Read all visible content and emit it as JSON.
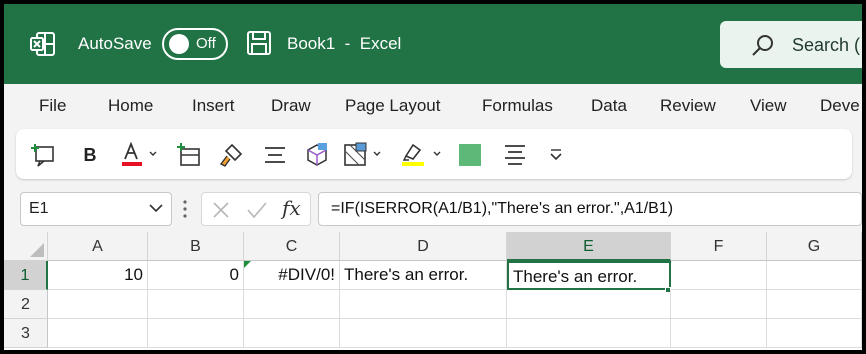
{
  "app": {
    "autosave_label": "AutoSave",
    "autosave_state": "Off",
    "doc_title": "Book1  -  Excel",
    "search_placeholder": "Search (",
    "brand_color": "#217346"
  },
  "ribbon": {
    "tabs": [
      "File",
      "Home",
      "Insert",
      "Draw",
      "Page Layout",
      "Formulas",
      "Data",
      "Review",
      "View",
      "Deve"
    ],
    "toolbar": {
      "bold_label": "B",
      "icons": [
        "new-comment-icon",
        "bold-icon",
        "font-color-icon",
        "insert-cells-icon",
        "format-painter-icon",
        "align-center-icon",
        "3d-shape-icon",
        "borders-icon",
        "highlight-icon",
        "fill-color-icon",
        "align-icon",
        "more-commands-icon"
      ],
      "font_color": "#e81123",
      "highlight_color": "#ffff00",
      "fill_color": "#5cb977"
    }
  },
  "formula_bar": {
    "name_box": "E1",
    "fx_label": "fx",
    "formula": "=IF(ISERROR(A1/B1),\"There's an error.\",A1/B1)"
  },
  "grid": {
    "columns": [
      "A",
      "B",
      "C",
      "D",
      "E",
      "F",
      "G"
    ],
    "rows": [
      "1",
      "2",
      "3"
    ],
    "selected_column": "E",
    "selected_row": "1",
    "row1": {
      "A": "10",
      "B": "0",
      "C": "#DIV/0!",
      "D": "There's an error.",
      "E": "There's an error."
    }
  }
}
